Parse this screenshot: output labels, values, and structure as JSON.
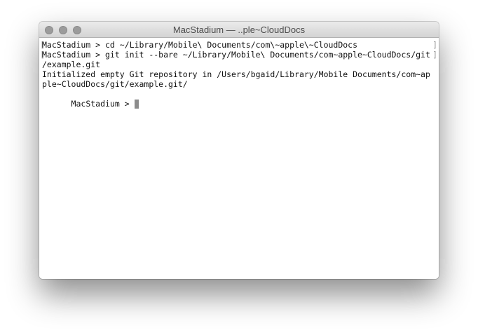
{
  "window": {
    "title": "MacStadium — ..ple~CloudDocs"
  },
  "terminal": {
    "lines": [
      "MacStadium > cd ~/Library/Mobile\\ Documents/com\\~apple\\~CloudDocs",
      "MacStadium > git init --bare ~/Library/Mobile\\ Documents/com~apple~CloudDocs/git",
      "/example.git",
      "Initialized empty Git repository in /Users/bgaid/Library/Mobile Documents/com~ap",
      "ple~CloudDocs/git/example.git/",
      "MacStadium > "
    ],
    "bracket_left": "[",
    "bracket_right": "]"
  },
  "colors": {
    "titlebar": "#d8d8d8",
    "text": "#111111",
    "cursor": "#8c8c8c"
  }
}
